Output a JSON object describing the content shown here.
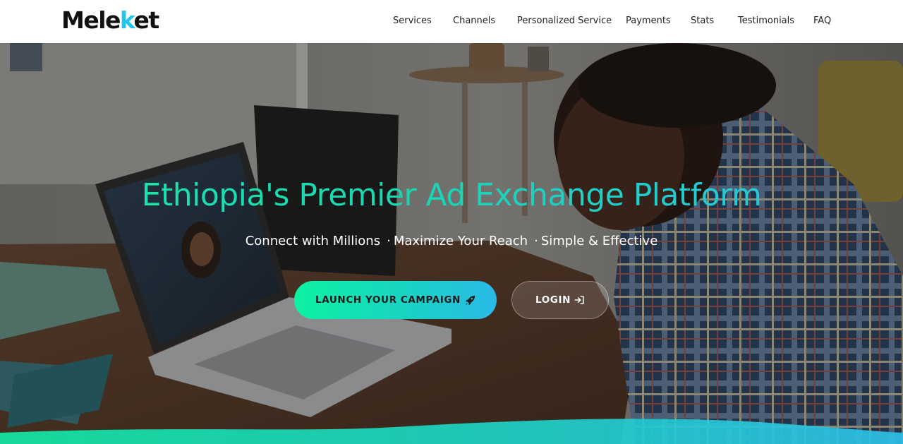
{
  "header": {
    "logo": {
      "part1": "Mele",
      "part2": "k",
      "part3": "et"
    },
    "nav": [
      "Services",
      "Channels",
      "Personalized Service",
      "Payments",
      "Stats",
      "Testimonials",
      "FAQ"
    ]
  },
  "hero": {
    "title": "Ethiopia's Premier Ad Exchange Platform",
    "subtitle": [
      "Connect with Millions",
      "Maximize Your Reach",
      "Simple & Effective"
    ],
    "separator": "·",
    "launch_button": {
      "label": "LAUNCH YOUR CAMPAIGN",
      "icon": "rocket-icon"
    },
    "login_button": {
      "label": "LOGIN",
      "icon": "sign-in-icon"
    }
  },
  "colors": {
    "accent_green": "#0cf2a2",
    "accent_cyan": "#2bb9e8",
    "logo_accent": "#23c6e8",
    "header_bg": "#ffffff"
  }
}
